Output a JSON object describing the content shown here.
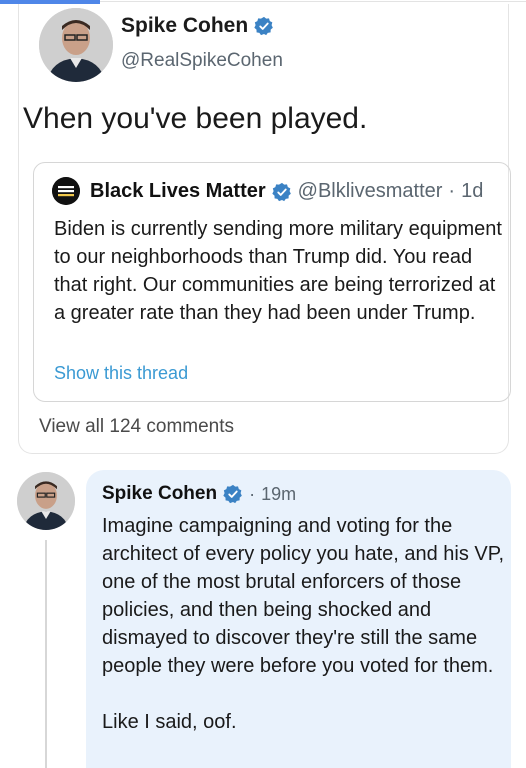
{
  "tweet": {
    "author_name": "Spike Cohen",
    "author_handle": "@RealSpikeCohen",
    "text": "Vhen you've been played.",
    "quoted": {
      "author_name": "Black Lives Matter",
      "author_handle": "@Blklivesmatter",
      "separator": "·",
      "time": "1d",
      "text": "Biden is currently sending more military equipment to our neighborhoods than Trump did. You read that right. Our communities are being terrorized at a greater rate than they had been under Trump.",
      "show_thread_label": "Show this thread"
    },
    "view_comments_label": "View all 124 comments"
  },
  "comment": {
    "author_name": "Spike Cohen",
    "separator": "·",
    "time": "19m",
    "text": "Imagine campaigning and voting for the architect of every policy you hate, and his VP, one of the most brutal enforcers of those policies, and then being shocked and dismayed to discover they're still the same people they were before you voted for them.\n\nLike I said, oof."
  },
  "colors": {
    "verified_badge": "#3b82c4",
    "link": "#3b9ad3",
    "comment_bubble": "#e9f2fc",
    "top_accent": "#4f86e8"
  },
  "icons": {
    "verified": "verified-badge-icon",
    "avatar_user": "user-photo",
    "avatar_org": "blm-logo"
  }
}
